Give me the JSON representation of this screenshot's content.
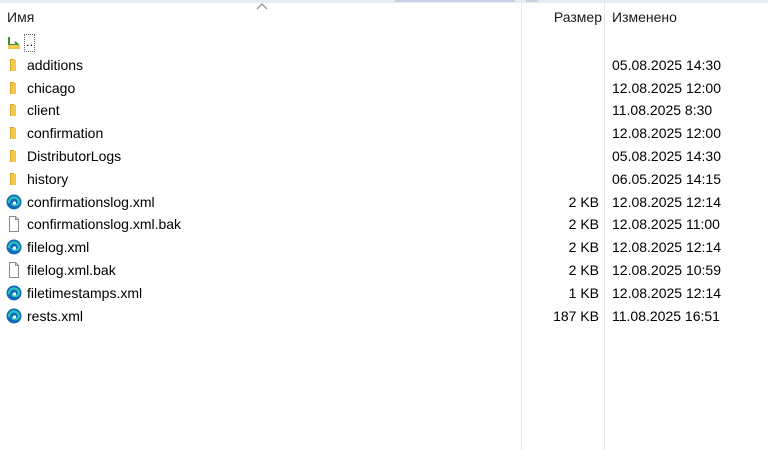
{
  "columns": {
    "name": "Имя",
    "size": "Размер",
    "modified": "Изменено"
  },
  "up_dir": {
    "label": "..",
    "icon": "folder-up-icon"
  },
  "rows": [
    {
      "type": "folder",
      "name": "additions",
      "size": "",
      "modified": "05.08.2025 14:30",
      "icon": "folder-icon"
    },
    {
      "type": "folder",
      "name": "chicago",
      "size": "",
      "modified": "12.08.2025 12:00",
      "icon": "folder-icon"
    },
    {
      "type": "folder",
      "name": "client",
      "size": "",
      "modified": "11.08.2025 8:30",
      "icon": "folder-icon"
    },
    {
      "type": "folder",
      "name": "confirmation",
      "size": "",
      "modified": "12.08.2025 12:00",
      "icon": "folder-icon"
    },
    {
      "type": "folder",
      "name": "DistributorLogs",
      "size": "",
      "modified": "05.08.2025 14:30",
      "icon": "folder-icon"
    },
    {
      "type": "folder",
      "name": "history",
      "size": "",
      "modified": "06.05.2025 14:15",
      "icon": "folder-icon"
    },
    {
      "type": "xml",
      "name": "confirmationslog.xml",
      "size": "2 KB",
      "modified": "12.08.2025 12:14",
      "icon": "edge-xml-icon"
    },
    {
      "type": "file",
      "name": "confirmationslog.xml.bak",
      "size": "2 KB",
      "modified": "12.08.2025 11:00",
      "icon": "blank-file-icon"
    },
    {
      "type": "xml",
      "name": "filelog.xml",
      "size": "2 KB",
      "modified": "12.08.2025 12:14",
      "icon": "edge-xml-icon"
    },
    {
      "type": "file",
      "name": "filelog.xml.bak",
      "size": "2 KB",
      "modified": "12.08.2025 10:59",
      "icon": "blank-file-icon"
    },
    {
      "type": "xml",
      "name": "filetimestamps.xml",
      "size": "1 KB",
      "modified": "12.08.2025 12:14",
      "icon": "edge-xml-icon"
    },
    {
      "type": "xml",
      "name": "rests.xml",
      "size": "187 KB",
      "modified": "11.08.2025 16:51",
      "icon": "edge-xml-icon"
    }
  ],
  "colors": {
    "folder": "#f2c94c",
    "folder_dark": "#dba628",
    "edge_blue": "#0f6cbd",
    "edge_teal": "#2ec4b6",
    "column_separator": "#e7e7e7"
  }
}
